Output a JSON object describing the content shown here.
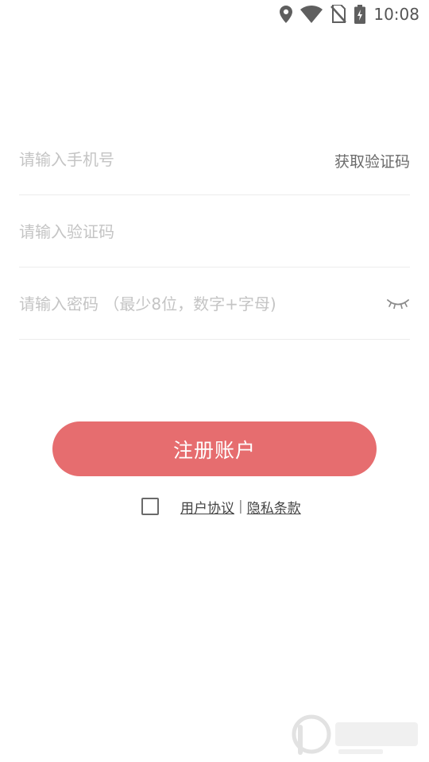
{
  "status_bar": {
    "time": "10:08",
    "icons": [
      "location-icon",
      "wifi-icon",
      "no-sim-icon",
      "battery-charging-icon"
    ]
  },
  "form": {
    "phone": {
      "placeholder": "请输入手机号",
      "value": ""
    },
    "get_code_label": "获取验证码",
    "code": {
      "placeholder": "请输入验证码",
      "value": ""
    },
    "password": {
      "placeholder": "请输入密码 （最少8位，数字+字母)",
      "value": "",
      "toggle_icon": "eye-closed-icon"
    }
  },
  "register_button_label": "注册账户",
  "agreement": {
    "checked": false,
    "user_agreement_label": "用户协议",
    "separator": "|",
    "privacy_label": "隐私条款"
  },
  "colors": {
    "accent": "#e66d6f",
    "placeholder": "#c4c4c4",
    "divider": "#ececec"
  }
}
